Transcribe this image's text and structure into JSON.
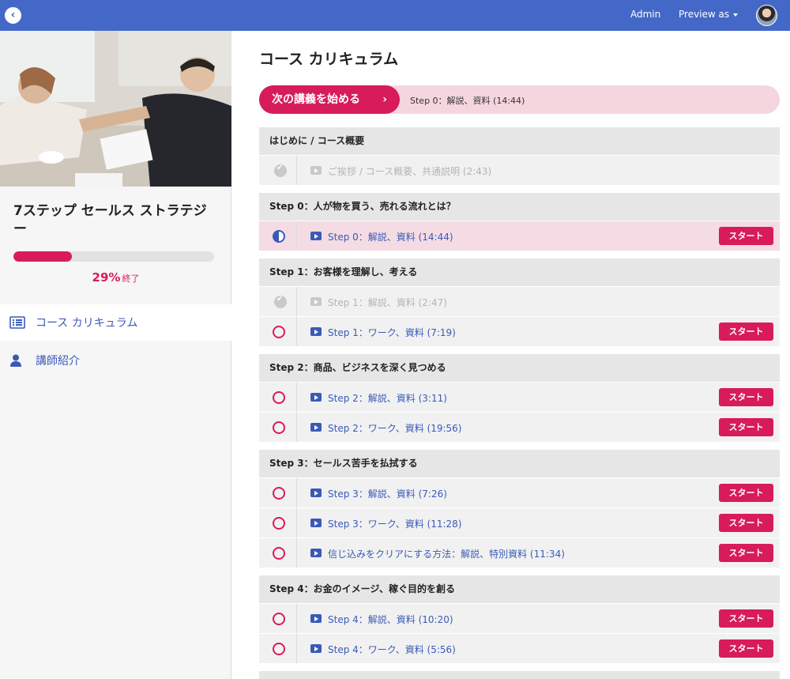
{
  "topbar": {
    "admin_label": "Admin",
    "preview_label": "Preview as"
  },
  "sidebar": {
    "course_title": "7ステップ セールス ストラテジー",
    "progress_value": 29,
    "progress_pct": "29%",
    "progress_suffix": "終了",
    "nav": [
      {
        "label": "コース カリキュラム",
        "icon": "curriculum-list-icon",
        "active": true
      },
      {
        "label": "講師紹介",
        "icon": "user-icon",
        "active": false
      }
    ]
  },
  "main": {
    "title": "コース カリキュラム",
    "next": {
      "button_label": "次の講義を始める",
      "lecture": "Step 0：解説、資料 (14:44)"
    },
    "start_label": "スタート",
    "sections": [
      {
        "title": "はじめに / コース概要",
        "lessons": [
          {
            "title": "ご挨拶 / コース概要、共通説明 (2:43)",
            "status": "done"
          }
        ]
      },
      {
        "title": "Step 0：人が物を買う、売れる流れとは？",
        "lessons": [
          {
            "title": "Step 0：解説、資料 (14:44)",
            "status": "in-progress"
          }
        ]
      },
      {
        "title": "Step 1：お客様を理解し、考える",
        "lessons": [
          {
            "title": "Step 1：解説、資料 (2:47)",
            "status": "done"
          },
          {
            "title": "Step 1：ワーク、資料 (7:19)",
            "status": "todo"
          }
        ]
      },
      {
        "title": "Step 2：商品、ビジネスを深く見つめる",
        "lessons": [
          {
            "title": "Step 2：解説、資料 (3:11)",
            "status": "todo"
          },
          {
            "title": "Step 2：ワーク、資料 (19:56)",
            "status": "todo"
          }
        ]
      },
      {
        "title": "Step 3：セールス苦手を払拭する",
        "lessons": [
          {
            "title": "Step 3：解説、資料 (7:26)",
            "status": "todo"
          },
          {
            "title": "Step 3：ワーク、資料 (11:28)",
            "status": "todo"
          },
          {
            "title": "信じ込みをクリアにする方法：解説、特別資料 (11:34)",
            "status": "todo"
          }
        ]
      },
      {
        "title": "Step 4：お金のイメージ、稼ぐ目的を創る",
        "lessons": [
          {
            "title": "Step 4：解説、資料 (10:20)",
            "status": "todo"
          },
          {
            "title": "Step 4：ワーク、資料 (5:56)",
            "status": "todo"
          }
        ]
      }
    ]
  },
  "colors": {
    "topbar": "#4468c8",
    "accent": "#d81b5a",
    "link": "#3a5ab8"
  }
}
